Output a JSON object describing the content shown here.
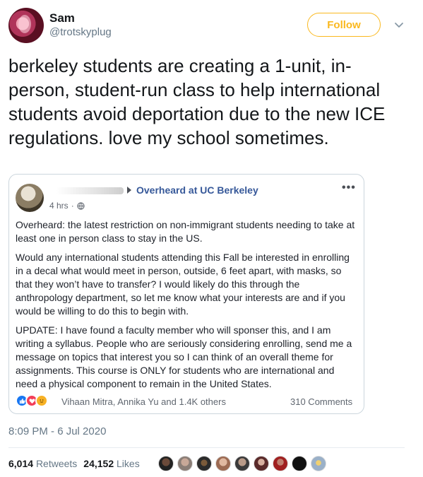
{
  "tweet": {
    "author_name": "Sam",
    "author_handle": "@trotskyplug",
    "follow_label": "Follow",
    "text": "berkeley students are creating a 1-unit, in-person, student-run class to help international students avoid deportation due to the new ICE regulations. love my school sometimes.",
    "timestamp": "8:09 PM - 6 Jul 2020",
    "retweets_count": "6,014",
    "retweets_label": "Retweets",
    "likes_count": "24,152",
    "likes_label": "Likes",
    "accent_color": "#fab81e"
  },
  "fb_post": {
    "group_name": "Overheard at UC Berkeley",
    "time_ago": "4 hrs",
    "separator": "·",
    "more_icon": "more-dots-icon",
    "paragraphs": [
      "Overheard: the latest restriction on non-immigrant students needing to take at least one in person class to stay in the US.",
      "Would any international students attending this Fall be interested in enrolling in a decal what would meet in person, outside, 6 feet apart, with masks, so that they won’t have to transfer? I would likely do this through the anthropology department, so let me know what your interests are and if you would be willing to do this to begin with.",
      "UPDATE: I have found a faculty member who will sponser this, and I am writing a syllabus. People who are seriously considering enrolling, send me a message on topics that interest you so I can think of an overall theme for assignments. This course is ONLY for students who are international and need a physical component to remain in the United States."
    ],
    "reaction_names": "Vihaan Mitra, Annika Yu and 1.4K others",
    "comments_label": "310 Comments",
    "link_color": "#365899"
  }
}
